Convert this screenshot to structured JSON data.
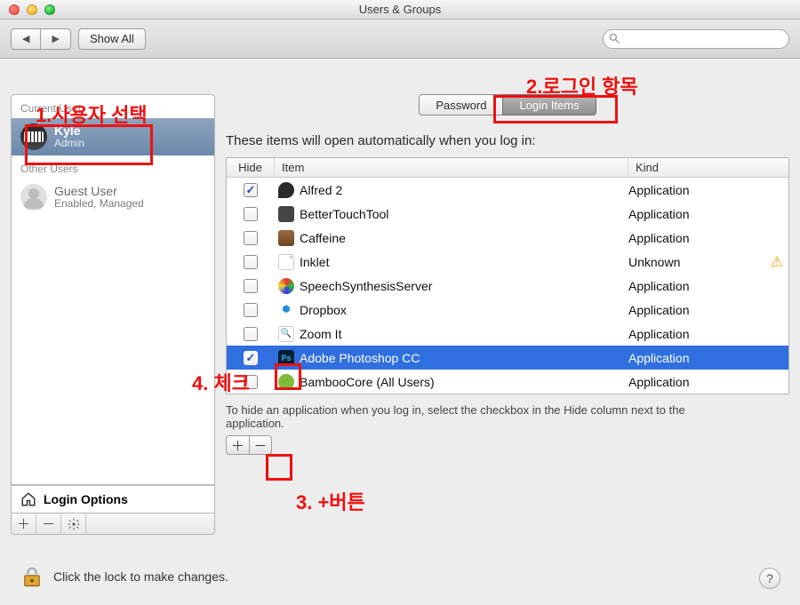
{
  "window_title": "Users & Groups",
  "toolbar": {
    "show_all": "Show All",
    "search_placeholder": ""
  },
  "sidebar": {
    "current_user_label": "Current User",
    "other_users_label": "Other Users",
    "users": [
      {
        "name": "Kyle",
        "role": "Admin",
        "selected": true,
        "avatar": "piano"
      },
      {
        "name": "Guest User",
        "role": "Enabled, Managed",
        "selected": false,
        "avatar": "sil"
      }
    ],
    "login_options_label": "Login Options"
  },
  "tabs": {
    "password": "Password",
    "login_items": "Login Items"
  },
  "main": {
    "description": "These items will open automatically when you log in:",
    "columns": {
      "hide": "Hide",
      "item": "Item",
      "kind": "Kind"
    },
    "rows": [
      {
        "hide": true,
        "icon": "ic-alfred",
        "name": "Alfred 2",
        "kind": "Application",
        "selected": false,
        "warn": false
      },
      {
        "hide": false,
        "icon": "ic-btt",
        "name": "BetterTouchTool",
        "kind": "Application",
        "selected": false,
        "warn": false
      },
      {
        "hide": false,
        "icon": "ic-caffeine",
        "name": "Caffeine",
        "kind": "Application",
        "selected": false,
        "warn": false
      },
      {
        "hide": false,
        "icon": "ic-inklet",
        "name": "Inklet",
        "kind": "Unknown",
        "selected": false,
        "warn": true
      },
      {
        "hide": false,
        "icon": "ic-speech",
        "name": "SpeechSynthesisServer",
        "kind": "Application",
        "selected": false,
        "warn": false
      },
      {
        "hide": false,
        "icon": "ic-dropbox",
        "name": "Dropbox",
        "kind": "Application",
        "selected": false,
        "warn": false
      },
      {
        "hide": false,
        "icon": "ic-zoom",
        "name": "Zoom It",
        "kind": "Application",
        "selected": false,
        "warn": false
      },
      {
        "hide": true,
        "icon": "ic-ps",
        "name": "Adobe Photoshop CC",
        "kind": "Application",
        "selected": true,
        "warn": false
      },
      {
        "hide": false,
        "icon": "ic-bamboo",
        "name": "BambooCore (All Users)",
        "kind": "Application",
        "selected": false,
        "warn": false
      }
    ],
    "hint": "To hide an application when you log in, select the checkbox in the Hide column next to the application."
  },
  "lock_text": "Click the lock to make changes.",
  "annotations": {
    "a1": "1.사용자 선택",
    "a2": "2.로그인 항목",
    "a3": "3. +버튼",
    "a4": "4. 체크"
  }
}
